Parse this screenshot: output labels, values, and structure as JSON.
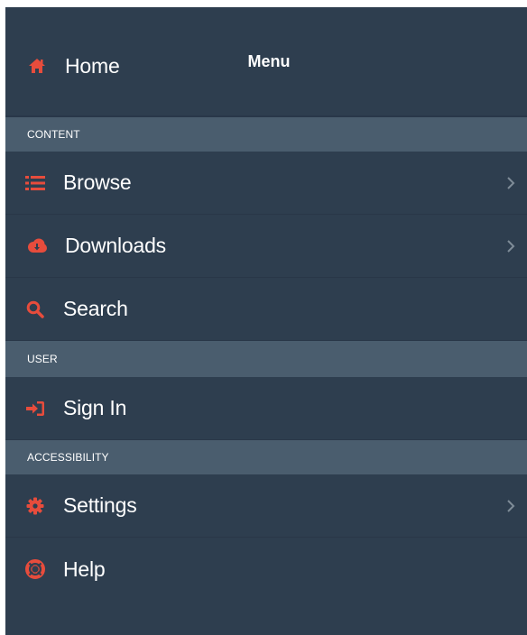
{
  "menu": {
    "title": "Menu",
    "home": {
      "label": "Home",
      "icon": "home-icon"
    },
    "sections": {
      "content": "CONTENT",
      "user": "USER",
      "accessibility": "ACCESSIBILITY"
    },
    "items": {
      "browse": {
        "label": "Browse",
        "icon": "list-icon"
      },
      "downloads": {
        "label": "Downloads",
        "icon": "cloud-download-icon"
      },
      "search": {
        "label": "Search",
        "icon": "search-icon"
      },
      "signin": {
        "label": "Sign In",
        "icon": "sign-in-icon"
      },
      "settings": {
        "label": "Settings",
        "icon": "gear-icon"
      },
      "help": {
        "label": "Help",
        "icon": "life-ring-icon"
      }
    }
  },
  "colors": {
    "background": "#2e3e4f",
    "section_background": "#4a5d6e",
    "icon_accent": "#e74c3c",
    "text": "#ffffff",
    "chevron": "#7f8c98"
  }
}
